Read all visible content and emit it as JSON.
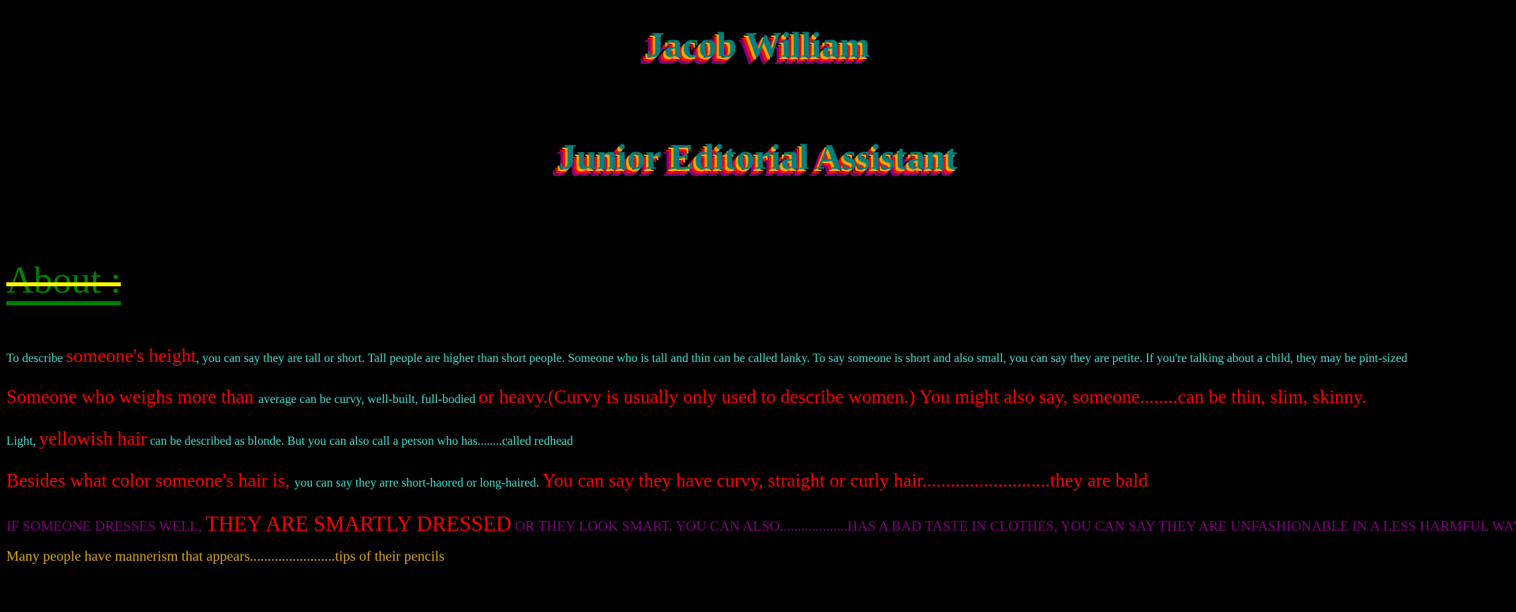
{
  "header": {
    "name": "Jacob William",
    "role": "Junior Editorial Assistant"
  },
  "about": {
    "heading": "About :"
  },
  "paragraphs": {
    "p1": [
      "To describe ",
      "someone's height",
      ", you can say they are tall or short. Tall people are higher than short people. Someone who is tall and thin can be called lanky. To say someone is short and also small, you can say they are petite. If you're talking about a child, they may be pint-sized"
    ],
    "p2": [
      "Someone who weighs more than ",
      "average can be curvy, well-built, full-bodied ",
      "or heavy.(Curvy is usually only used to describe women.) You might also say, someone........can be thin, slim, skinny."
    ],
    "p3": [
      "Light, ",
      "yellowish hair",
      " can be described as blonde. But you can also call a person who has........called redhead"
    ],
    "p4": [
      "Besides what color someone's hair is, ",
      "you can say they arre short-haored or long-haired. ",
      "You can say they have curvy, straight or curly hair...........................they are bald"
    ],
    "p5": [
      "IF SOMEONE DRESSES WELL, ",
      "THEY ARE SMARTLY DRESSED",
      " OR THEY LOOK SMART. YOU CAN ALSO...................HAS A BAD TASTE IN CLOTHES, YOU CAN SAY THEY ARE UNFASHIONABLE IN A LESS HARMFUL WAY"
    ],
    "p6": "Many people have mannerism that appears........................tips of their pencils"
  },
  "colors": {
    "background": "#000000",
    "title_fill": "#008080",
    "title_shadows": [
      "#ffa500",
      "#ff0000",
      "#800080"
    ],
    "about_heading": "#008000",
    "about_strike": "#ffff00",
    "body_text": "#40e0d0",
    "emphasis": "#ff0000",
    "uppercase_text": "#800080",
    "last_line": "#daa520"
  }
}
